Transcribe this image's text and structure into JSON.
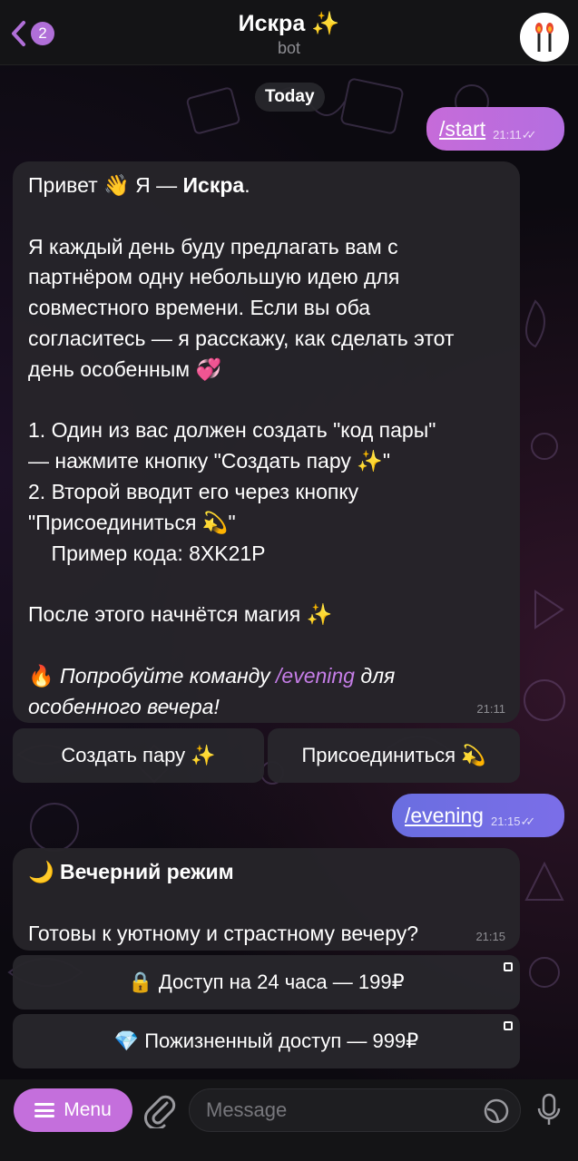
{
  "header": {
    "back_badge": "2",
    "title": "Искра ✨",
    "subtitle": "bot"
  },
  "date_separator": "Today",
  "messages": {
    "out_start": {
      "text": "/start",
      "time": "21:11"
    },
    "welcome": {
      "lines": [
        "Привет 👋 Я — ",
        "",
        "Я каждый день буду предлагать вам с",
        "партнёром одну небольшую идею для",
        "совместного времени. Если вы оба",
        "согласитесь — я расскажу, как сделать этот",
        "день особенным 💞",
        "",
        "1. Один из вас должен создать \"код пары\"",
        "— нажмите кнопку \"Создать пару ✨\"",
        "2. Второй вводит его через кнопку",
        "\"Присоединиться 💫\"",
        "    Пример кода: 8XK21P",
        "",
        "После этого начнётся магия ✨",
        ""
      ],
      "bot_name": "Искра",
      "name_period": ".",
      "tip_prefix": "🔥 ",
      "tip_italic_1": "Попробуйте команду ",
      "tip_link": "/evening",
      "tip_italic_2": " для",
      "tip_italic_3": "особенного вечера!",
      "time": "21:11"
    },
    "out_evening": {
      "text": "/evening",
      "time": "21:15"
    },
    "evening": {
      "heading": "🌙 Вечерний режим",
      "body": "Готовы к уютному и страстному вечеру?",
      "time": "21:15"
    }
  },
  "buttons": {
    "create_pair": "Создать пару ✨",
    "join": "Присоединиться 💫",
    "access_24h": "🔒 Доступ на 24 часа — 199₽",
    "lifetime": "💎 Пожизненный доступ — 999₽"
  },
  "input": {
    "menu_label": "Menu",
    "placeholder": "Message"
  },
  "colors": {
    "accent": "#c46fdc",
    "evening_bubble": "#6a6ee0",
    "incoming_bubble": "#26242a"
  }
}
